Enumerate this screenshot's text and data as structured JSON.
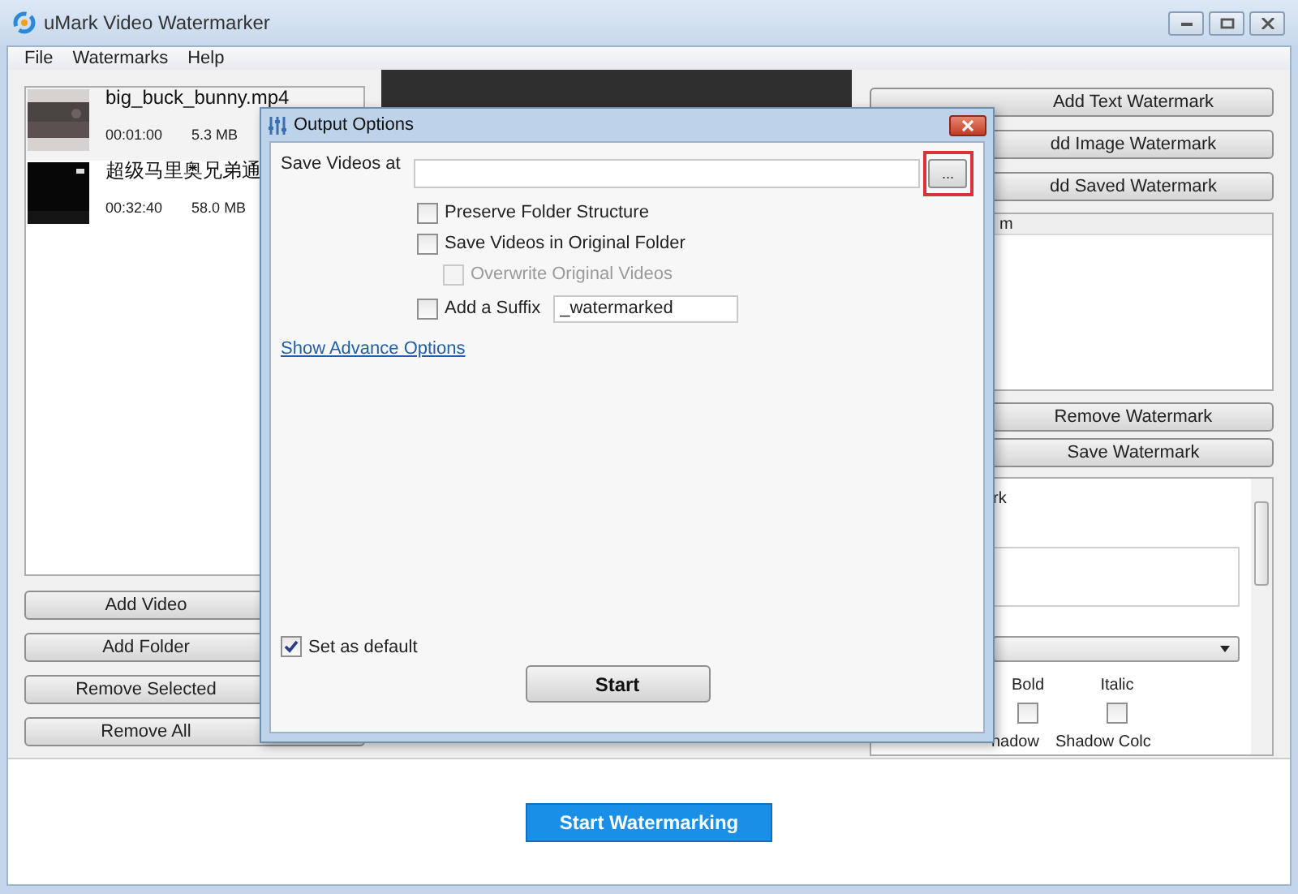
{
  "window": {
    "title": "uMark Video Watermarker"
  },
  "menu": [
    "File",
    "Watermarks",
    "Help"
  ],
  "videos": [
    {
      "name": "big_buck_bunny.mp4",
      "duration": "00:01:00",
      "size": "5.3 MB",
      "selected": true
    },
    {
      "name": "超级马里奥兄弟通",
      "duration": "00:32:40",
      "size": "58.0 MB",
      "selected": false
    }
  ],
  "video_buttons": [
    "Add Video",
    "Add Folder",
    "Remove Selected",
    "Remove All"
  ],
  "add_buttons": [
    "Add Text Watermark",
    "dd Image Watermark",
    "dd Saved Watermark"
  ],
  "watermark_list": {
    "header": "m"
  },
  "watermark_buttons": [
    "Remove Watermark",
    "Save Watermark"
  ],
  "properties": {
    "heading": "rk",
    "styles": [
      {
        "label": "Bold",
        "checked": false
      },
      {
        "label": "Italic",
        "checked": false
      }
    ],
    "shadow_labels": [
      "hadow",
      "Shadow Colc"
    ]
  },
  "start_button": "Start Watermarking",
  "dialog": {
    "title": "Output Options",
    "save_label": "Save Videos at",
    "browse": "...",
    "browse_highlighted": true,
    "options": [
      {
        "kind": "check",
        "label": "Preserve Folder Structure",
        "checked": false,
        "disabled": false
      },
      {
        "kind": "check",
        "label": "Save Videos in Original Folder",
        "checked": false,
        "disabled": false,
        "children": [
          {
            "kind": "check",
            "label": "Overwrite Original Videos",
            "checked": false,
            "disabled": true
          }
        ]
      },
      {
        "kind": "suffix",
        "label": "Add a Suffix",
        "checked": false,
        "disabled": false,
        "value": "_watermarked"
      }
    ],
    "link": "Show Advance Options",
    "default": {
      "label": "Set as default",
      "checked": true
    },
    "start": "Start"
  }
}
